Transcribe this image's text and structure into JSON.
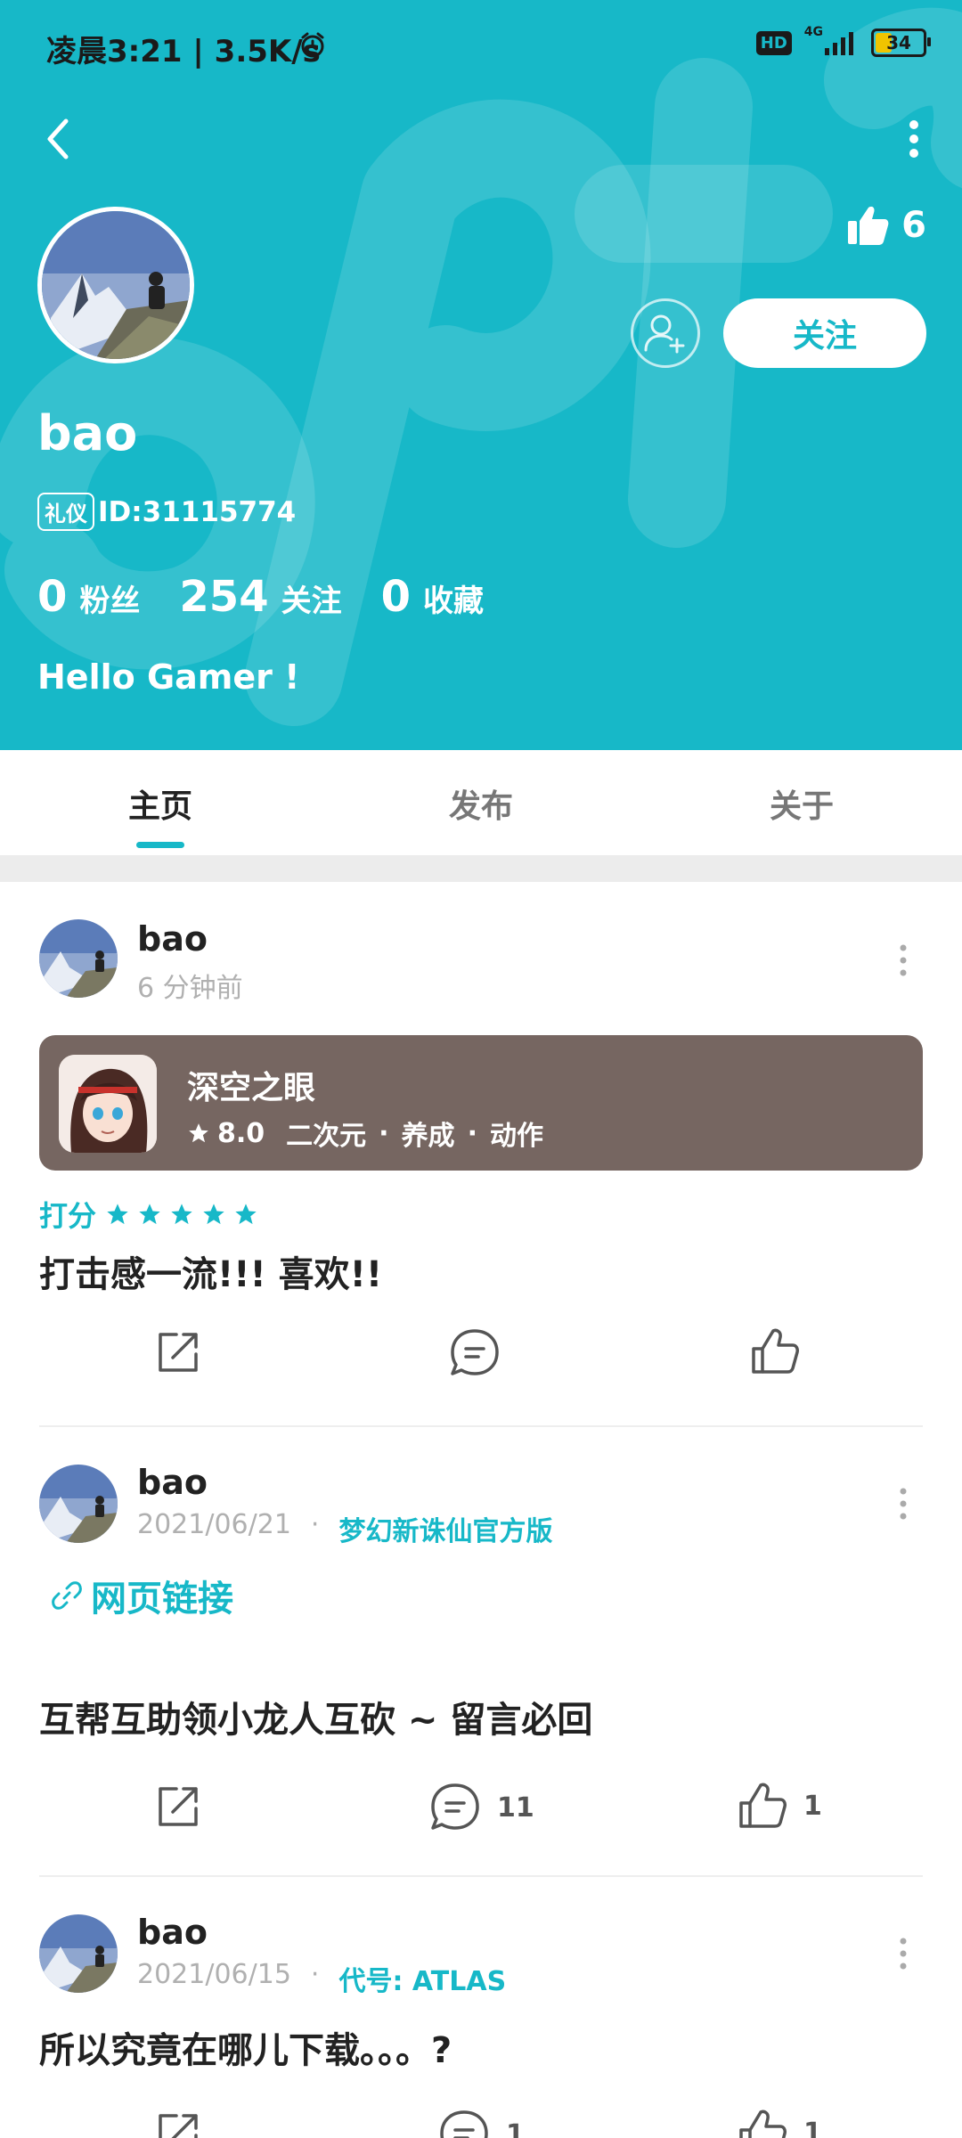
{
  "status_bar": {
    "left_text": "凌晨3:21 | 3.5K/s",
    "hd_label": "HD",
    "network_label": "4G",
    "battery_level": "34"
  },
  "colors": {
    "accent": "#17b8c8",
    "game_card": "#766661"
  },
  "profile": {
    "like_count": "6",
    "follow_label": "关注",
    "username": "bao",
    "id_badge": "礼仪",
    "id_text": "ID:31115774",
    "stats": [
      {
        "value": "0",
        "label": "粉丝"
      },
      {
        "value": "254",
        "label": "关注"
      },
      {
        "value": "0",
        "label": "收藏"
      }
    ],
    "bio": "Hello Gamer !"
  },
  "tabs": [
    {
      "label": "主页",
      "active": true
    },
    {
      "label": "发布",
      "active": false
    },
    {
      "label": "关于",
      "active": false
    }
  ],
  "posts": [
    {
      "author": "bao",
      "time": "6 分钟前",
      "game_card": {
        "name": "深空之眼",
        "score": "8.0",
        "tags": [
          "二次元",
          "养成",
          "动作"
        ],
        "separator": "·"
      },
      "rating_label": "打分",
      "rating_stars": 5,
      "text": "打击感一流!!! 喜欢!!",
      "comment_count": "",
      "like_count": ""
    },
    {
      "author": "bao",
      "time": "2021/06/21",
      "separator": "·",
      "game": "梦幻新诛仙官方版",
      "link_label": "网页链接",
      "text": "互帮互助领小龙人互砍 ~ 留言必回",
      "comment_count": "11",
      "like_count": "1"
    },
    {
      "author": "bao",
      "time": "2021/06/15",
      "separator": "·",
      "game": "代号: ATLAS",
      "text": "所以究竟在哪儿下载。。。?",
      "comment_count": "1",
      "like_count": "1"
    }
  ]
}
